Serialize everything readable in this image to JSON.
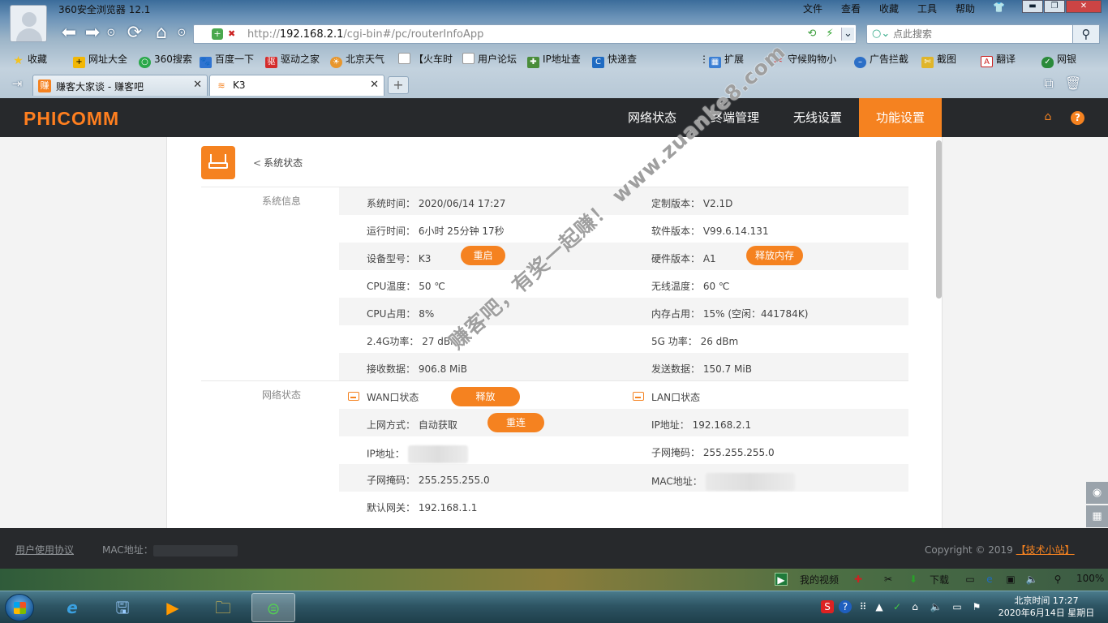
{
  "browser": {
    "app_title": "360安全浏览器 12.1",
    "menu": [
      "文件",
      "查看",
      "收藏",
      "工具",
      "帮助"
    ],
    "url_prefix": "http://",
    "url_host": "192.168.2.1",
    "url_path": "/cgi-bin#/pc/routerInfoApp",
    "search_placeholder": "点此搜索",
    "bookmarks": [
      "收藏",
      "网址大全",
      "360搜索",
      "百度一下",
      "驱动之家",
      "北京天气",
      "【火车时",
      "用户论坛",
      "IP地址查",
      "快递查",
      "扩展",
      "守候购物小",
      "广告拦截",
      "截图",
      "翻译",
      "网银"
    ],
    "tabs": [
      {
        "title": "赚客大家谈 - 赚客吧",
        "icon": "赚"
      },
      {
        "title": "K3",
        "icon": "wifi"
      }
    ]
  },
  "router": {
    "logo": "PHICOMM",
    "nav": [
      "网络状态",
      "终端管理",
      "无线设置",
      "功能设置"
    ],
    "back_label": "系统状态",
    "system": {
      "label": "系统信息",
      "left": [
        {
          "k": "系统时间：",
          "v": "2020/06/14 17:27"
        },
        {
          "k": "运行时间：",
          "v": "6小时 25分钟 17秒"
        },
        {
          "k": "设备型号：",
          "v": "K3"
        },
        {
          "k": "CPU温度：",
          "v": "50 ℃"
        },
        {
          "k": "CPU占用：",
          "v": "8%"
        },
        {
          "k": "2.4G功率：",
          "v": "27 dBm"
        },
        {
          "k": "接收数据：",
          "v": "906.8 MiB"
        }
      ],
      "right": [
        {
          "k": "定制版本：",
          "v": "V2.1D"
        },
        {
          "k": "软件版本：",
          "v": "V99.6.14.131"
        },
        {
          "k": "硬件版本：",
          "v": "A1"
        },
        {
          "k": "无线温度：",
          "v": "60 ℃"
        },
        {
          "k": "内存占用：",
          "v": "15% (空闲：441784K)"
        },
        {
          "k": "5G 功率：",
          "v": "26 dBm"
        },
        {
          "k": "发送数据：",
          "v": "150.7 MiB"
        }
      ],
      "reboot_btn": "重启",
      "release_mem_btn": "释放内存"
    },
    "network": {
      "label": "网络状态",
      "wan_title": "WAN口状态",
      "lan_title": "LAN口状态",
      "release_btn": "释放",
      "reconnect_btn": "重连",
      "wan": [
        {
          "k": "上网方式：",
          "v": "自动获取"
        },
        {
          "k": "IP地址：",
          "v": ""
        },
        {
          "k": "子网掩码：",
          "v": "255.255.255.0"
        },
        {
          "k": "默认网关：",
          "v": "192.168.1.1"
        }
      ],
      "lan": [
        {
          "k": "IP地址：",
          "v": "192.168.2.1"
        },
        {
          "k": "子网掩码：",
          "v": "255.255.255.0"
        },
        {
          "k": "MAC地址：",
          "v": ""
        }
      ]
    },
    "watermark": "赚客吧，有奖一起赚！ www.zuanke8.com",
    "footer": {
      "agreement": "用户使用协议",
      "mac_label": "MAC地址：",
      "copyright": "Copyright © 2019",
      "tech_site": "【技术小站】"
    }
  },
  "statusbar": {
    "video": "我的视频",
    "download": "下载",
    "zoom": "100%"
  },
  "taskbar": {
    "clock_time": "北京时间 17:27",
    "clock_date": "2020年6月14日 星期日"
  }
}
